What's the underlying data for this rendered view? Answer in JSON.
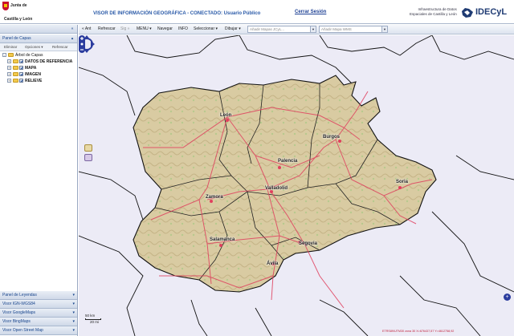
{
  "header": {
    "logo_line1": "Junta de",
    "logo_line2": "Castilla y León",
    "title": "VISOR DE INFORMACIÓN GEOGRÁFICA - CONECTADO: Usuario Público",
    "logout_label": "Cerrar Sesión",
    "idecyl_line1": "Infraestructura de Datos",
    "idecyl_line2": "Espaciales de Castilla y León",
    "idecyl_word": "IDECyL"
  },
  "toolbar": {
    "items": [
      {
        "label": "« Ant"
      },
      {
        "label": "Refrescar"
      },
      {
        "label": "Sig »"
      },
      {
        "label": "MENU ▾"
      },
      {
        "label": "Navegar"
      },
      {
        "label": "INFO"
      },
      {
        "label": "Seleccionar ▾"
      },
      {
        "label": "Dibujar ▾"
      }
    ],
    "combo1_placeholder": "Añadir Mapas JCyL...",
    "combo2_placeholder": "Añadir Mapa WMS"
  },
  "left_panel": {
    "title": "Panel de Capas",
    "collapse_glyph": "«",
    "actions": [
      "Eliminar",
      "Opciones ▾",
      "Refrescar"
    ],
    "tree_root": "Árbol de Capas",
    "tree_items": [
      {
        "label": "DATOS DE REFERENCIA"
      },
      {
        "label": "MAPA"
      },
      {
        "label": "IMAGEN"
      },
      {
        "label": "RELIEVE"
      }
    ],
    "collapsed_panels": [
      {
        "label": "Panel de Leyendas"
      },
      {
        "label": "Visor IGN-WGS84"
      },
      {
        "label": "Visor GoogleMaps"
      },
      {
        "label": "Visor BingMaps"
      },
      {
        "label": "Visor Open Street Map"
      }
    ]
  },
  "map": {
    "cities": {
      "leon": "León",
      "burgos": "Burgos",
      "palencia": "Palencia",
      "soria": "Soria",
      "zamora": "Zamora",
      "valladolid": "Valladolid",
      "salamanca": "Salamanca",
      "segovia": "Segovia",
      "avila": "Ávila"
    },
    "scale_top": "50 km",
    "scale_bottom": "20 mi",
    "coords_text": "ETRS89/UTM30 zona 30  X=676437,57  Y=4612758,92"
  },
  "colors": {
    "accent": "#15428b",
    "region_fill": "#d8c9a0",
    "road": "#e0405e",
    "map_bg": "#ecebf6"
  }
}
